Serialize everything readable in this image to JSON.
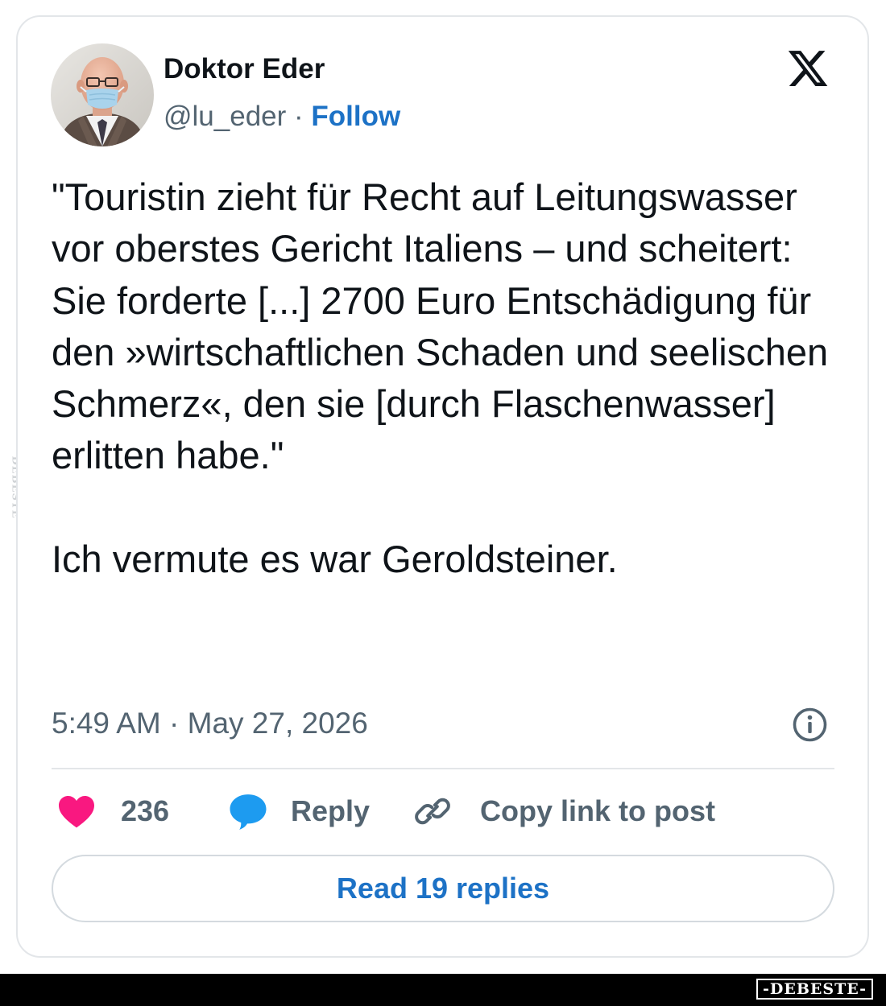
{
  "author": {
    "name": "Doktor Eder",
    "handle": "@lu_eder",
    "separator": "·",
    "follow_label": "Follow"
  },
  "tweet": {
    "paragraphs": [
      "\"Touristin zieht für Recht auf Leitungswasser vor oberstes Gericht Italiens – und scheitert:",
      "Sie forderte [...] 2700 Euro Entschädigung für den »wirtschaftlichen Schaden und seelischen Schmerz«, den sie [durch Flaschenwasser] erlitten habe.\"",
      "Ich vermute es war Geroldsteiner."
    ],
    "timestamp": "5:49 AM · May 27, 2026"
  },
  "actions": {
    "like_count": "236",
    "reply_label": "Reply",
    "copy_link_label": "Copy link to post"
  },
  "read_replies_label": "Read 19 replies",
  "watermark": {
    "side_text": "DEBESTE",
    "footer_text": "-DEBESTE-"
  },
  "icons": {
    "x_logo": "x-logo-icon",
    "info": "info-icon",
    "like": "heart-icon",
    "reply": "speech-bubble-icon",
    "copy": "link-icon"
  },
  "colors": {
    "link_blue": "#1d72c6",
    "heart_pink": "#f91880",
    "reply_blue": "#1d9bf0",
    "secondary_text": "#536471",
    "primary_text": "#0f1419"
  }
}
